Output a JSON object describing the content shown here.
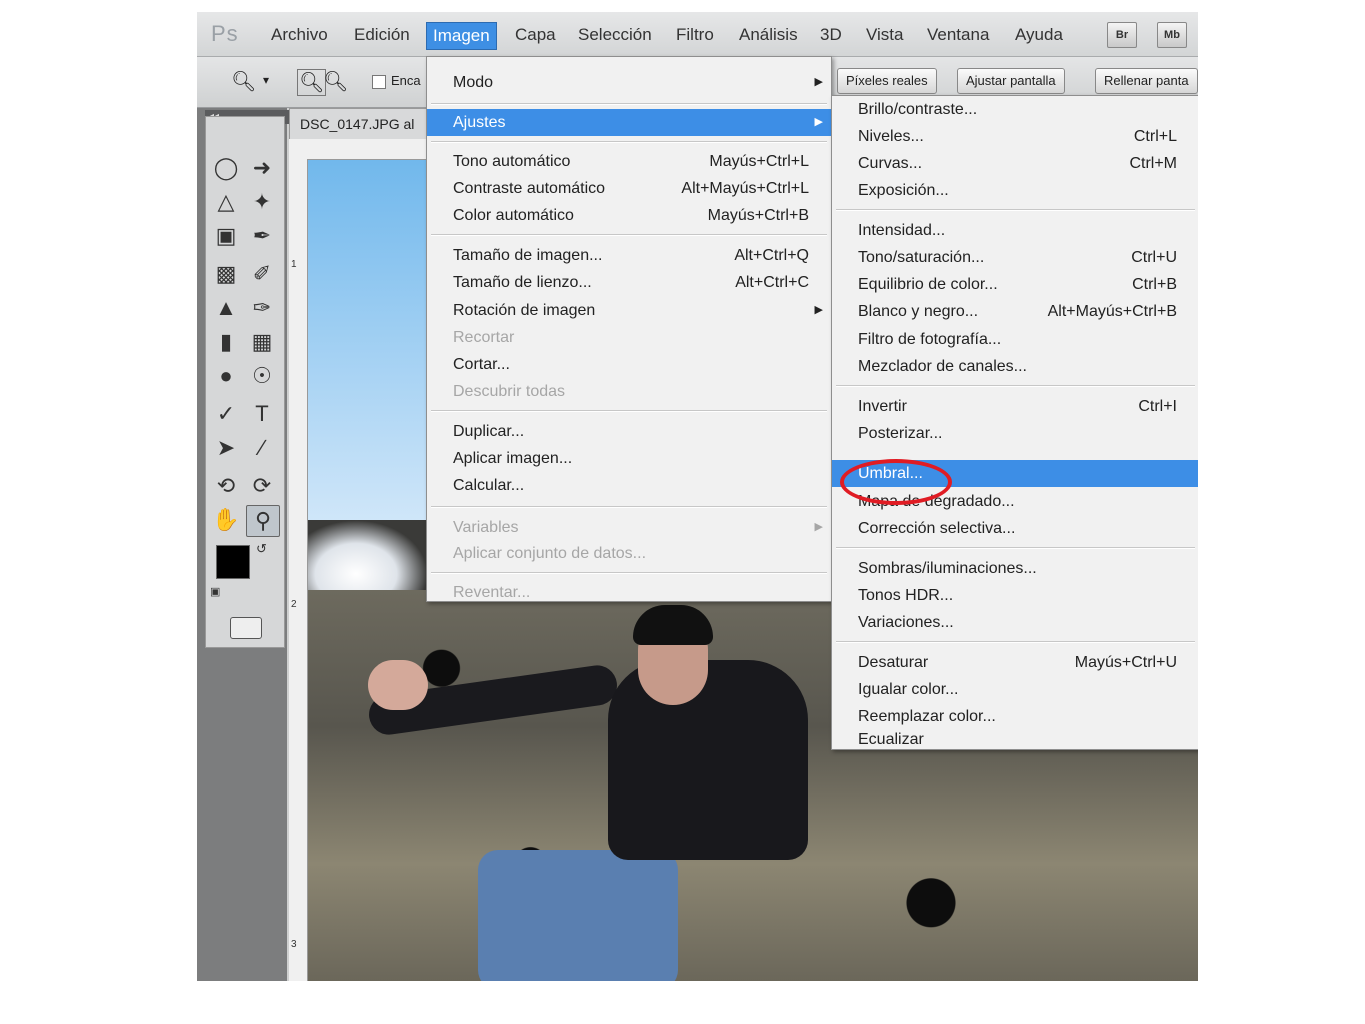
{
  "menubar": {
    "logo": "Ps",
    "items": [
      "Archivo",
      "Edición",
      "Imagen",
      "Capa",
      "Selección",
      "Filtro",
      "Análisis",
      "3D",
      "Vista",
      "Ventana",
      "Ayuda"
    ],
    "btn_br": "Br",
    "btn_mb": "Mb"
  },
  "options": {
    "checkbox_label": "Enca",
    "btn_pixels": "Píxeles reales",
    "btn_fit": "Ajustar pantalla",
    "btn_fill": "Rellenar panta"
  },
  "document": {
    "tab": "DSC_0147.JPG al",
    "ruler_marks": [
      "1",
      "2",
      "3"
    ]
  },
  "imagen_menu": {
    "modo": "Modo",
    "ajustes": "Ajustes",
    "tono_auto": "Tono automático",
    "tono_auto_sc": "Mayús+Ctrl+L",
    "contraste_auto": "Contraste automático",
    "contraste_auto_sc": "Alt+Mayús+Ctrl+L",
    "color_auto": "Color automático",
    "color_auto_sc": "Mayús+Ctrl+B",
    "tamano_imagen": "Tamaño de imagen...",
    "tamano_imagen_sc": "Alt+Ctrl+Q",
    "tamano_lienzo": "Tamaño de lienzo...",
    "tamano_lienzo_sc": "Alt+Ctrl+C",
    "rotacion": "Rotación de imagen",
    "recortar": "Recortar",
    "cortar": "Cortar...",
    "descubrir": "Descubrir todas",
    "duplicar": "Duplicar...",
    "aplicar_imagen": "Aplicar imagen...",
    "calcular": "Calcular...",
    "variables": "Variables",
    "aplicar_conjunto": "Aplicar conjunto de datos...",
    "reventar": "Reventar..."
  },
  "ajustes_menu": {
    "brillo": "Brillo/contraste...",
    "niveles": "Niveles...",
    "niveles_sc": "Ctrl+L",
    "curvas": "Curvas...",
    "curvas_sc": "Ctrl+M",
    "exposicion": "Exposición...",
    "intensidad": "Intensidad...",
    "tono_sat": "Tono/saturación...",
    "tono_sat_sc": "Ctrl+U",
    "equilibrio": "Equilibrio de color...",
    "equilibrio_sc": "Ctrl+B",
    "blanco_negro": "Blanco y negro...",
    "blanco_negro_sc": "Alt+Mayús+Ctrl+B",
    "filtro_foto": "Filtro de fotografía...",
    "mezclador": "Mezclador de canales...",
    "invertir": "Invertir",
    "invertir_sc": "Ctrl+I",
    "posterizar": "Posterizar...",
    "umbral": "Umbral...",
    "mapa": "Mapa de degradado...",
    "correccion": "Corrección selectiva...",
    "sombras": "Sombras/iluminaciones...",
    "tonos_hdr": "Tonos HDR...",
    "variaciones": "Variaciones...",
    "desaturar": "Desaturar",
    "desaturar_sc": "Mayús+Ctrl+U",
    "igualar": "Igualar color...",
    "reemplazar": "Reemplazar color...",
    "ecualizar": "Ecualizar"
  },
  "colors": {
    "highlight": "#3d8ee6",
    "annotation": "#e01c24"
  }
}
